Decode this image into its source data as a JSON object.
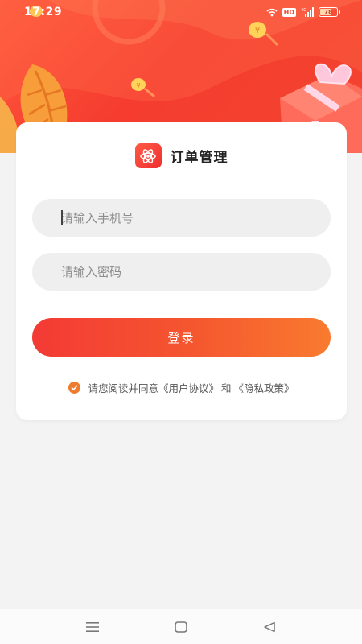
{
  "status_bar": {
    "time": "17:29",
    "network": "HD",
    "signal_label": "4G",
    "battery_level": 0.62,
    "battery_text": "78"
  },
  "brand": {
    "title": "订单管理",
    "logo_icon": "atom-icon"
  },
  "form": {
    "phone_placeholder": "请输入手机号",
    "password_placeholder": "请输入密码",
    "login_label": "登录"
  },
  "agreement": {
    "prefix": "请您阅读并同意",
    "user_agreement": "《用户协议》",
    "conjunction": "和",
    "privacy_policy": "《隐私政策》",
    "checked": true
  },
  "colors": {
    "accent": "#f5452f",
    "accent_orange": "#f07b2e",
    "background": "#f3f3f3"
  },
  "nav": {
    "menu_icon": "menu-icon",
    "home_icon": "home-icon",
    "back_icon": "back-icon"
  }
}
